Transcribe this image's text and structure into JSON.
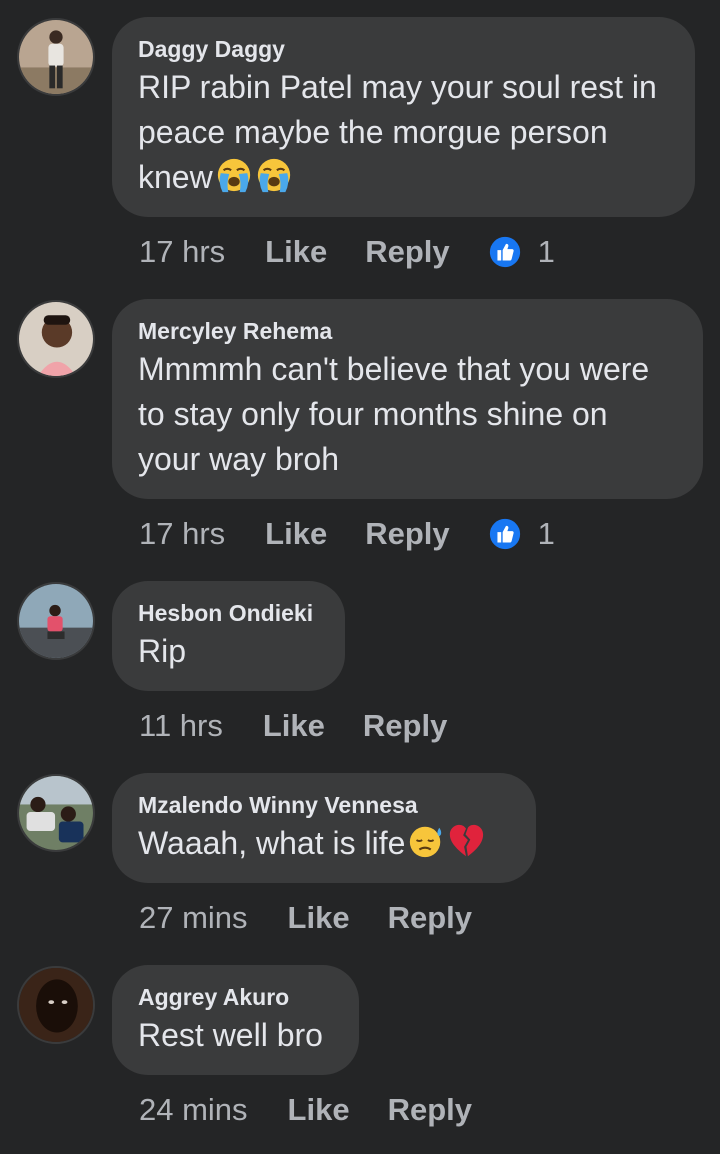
{
  "comments": [
    {
      "author": "Daggy Daggy",
      "text": "RIP rabin Patel may your soul rest in peace maybe the morgue person knew",
      "emojis": [
        "loudly-crying-face",
        "loudly-crying-face"
      ],
      "time": "17 hrs",
      "like_label": "Like",
      "reply_label": "Reply",
      "reaction_count": "1"
    },
    {
      "author": "Mercyley Rehema",
      "text": "Mmmmh can't believe that you were to stay only four months shine on your way broh",
      "time": "17 hrs",
      "like_label": "Like",
      "reply_label": "Reply",
      "reaction_count": "1"
    },
    {
      "author": "Hesbon Ondieki",
      "text": "Rip",
      "time": "11 hrs",
      "like_label": "Like",
      "reply_label": "Reply"
    },
    {
      "author": "Mzalendo Winny Vennesa",
      "text": "Waaah, what is life",
      "emojis": [
        "downcast-face-with-sweat",
        "broken-heart"
      ],
      "time": "27 mins",
      "like_label": "Like",
      "reply_label": "Reply"
    },
    {
      "author": "Aggrey Akuro",
      "text": "Rest well bro",
      "time": "24 mins",
      "like_label": "Like",
      "reply_label": "Reply"
    }
  ],
  "colors": {
    "background": "#242526",
    "bubble": "#3a3b3c",
    "text": "#e4e6eb",
    "secondary_text": "#b0b3b8",
    "like_reaction": "#1877f2"
  }
}
